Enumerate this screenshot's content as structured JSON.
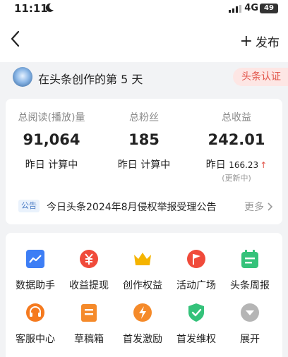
{
  "status_bar": {
    "time": "11:11",
    "network": "4G",
    "battery": "49"
  },
  "nav": {
    "back_icon": "chevron-left-icon",
    "publish_icon": "plus-icon",
    "publish_label": "发布"
  },
  "creator": {
    "days_text": "在头条创作的第 5 天",
    "cert_label": "头条认证"
  },
  "stats": [
    {
      "label": "总阅读(播放)量",
      "value": "91,064",
      "sub": "昨日 计算中"
    },
    {
      "label": "总粉丝",
      "value": "185",
      "sub": "昨日 计算中"
    },
    {
      "label": "总收益",
      "value": "242.01",
      "sub_prefix": "昨日",
      "sub_value": "166.23",
      "sub_arrow": "↑",
      "sub_note": "(更新中)"
    }
  ],
  "notice": {
    "tag": "公告",
    "text": "今日头条2024年8月侵权举报受理公告",
    "more": "更多"
  },
  "tools": [
    {
      "label": "数据助手",
      "icon": "chart-icon",
      "color": "#3d7ef5"
    },
    {
      "label": "收益提现",
      "icon": "yuan-icon",
      "color": "#f04a3a"
    },
    {
      "label": "创作权益",
      "icon": "crown-icon",
      "color": "#f5b400"
    },
    {
      "label": "活动广场",
      "icon": "flag-icon",
      "color": "#f04a3a"
    },
    {
      "label": "头条周报",
      "icon": "calendar-icon",
      "color": "#34c27a"
    },
    {
      "label": "客服中心",
      "icon": "headset-icon",
      "color": "#f57a1f"
    },
    {
      "label": "草稿箱",
      "icon": "draft-icon",
      "color": "#f58a2a"
    },
    {
      "label": "首发激励",
      "icon": "lightning-icon",
      "color": "#f58a2a"
    },
    {
      "label": "首发维权",
      "icon": "shield-check-icon",
      "color": "#34c27a"
    },
    {
      "label": "展开",
      "icon": "expand-down-icon",
      "color": "#b5b5b5"
    }
  ]
}
